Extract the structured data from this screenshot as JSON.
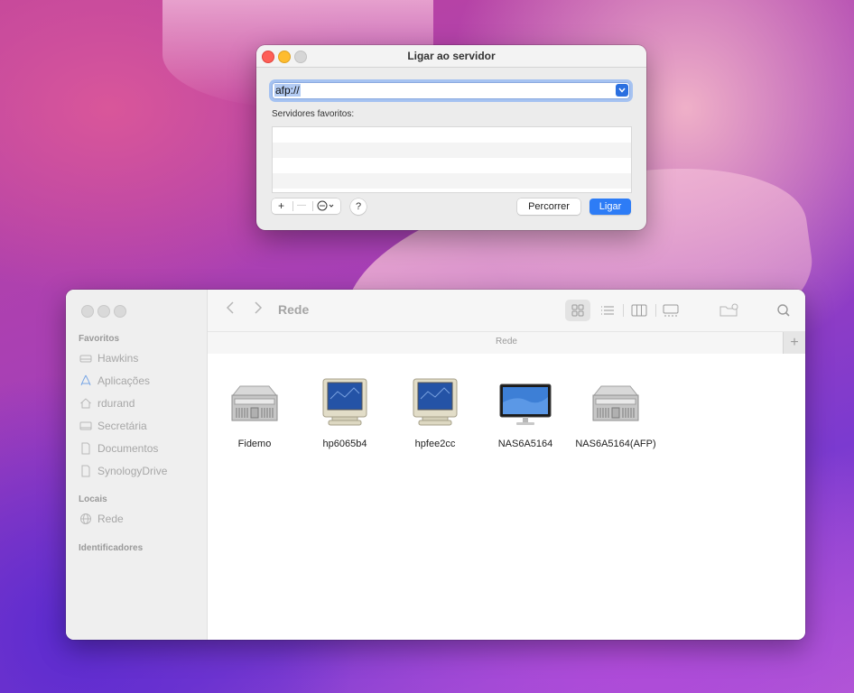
{
  "dialog": {
    "title": "Ligar ao servidor",
    "address_value": "afp://",
    "favorites_label": "Servidores favoritos:",
    "seg_add": "+",
    "seg_remove": "—",
    "seg_more": "⋯",
    "help_label": "?",
    "browse_label": "Percorrer",
    "connect_label": "Ligar"
  },
  "finder": {
    "title": "Rede",
    "path_title": "Rede",
    "plus_tab": "+",
    "sidebar": {
      "favorites_header": "Favoritos",
      "favorites": [
        {
          "label": "Hawkins",
          "icon": "hd-icon"
        },
        {
          "label": "Aplicações",
          "icon": "apps-icon"
        },
        {
          "label": "rdurand",
          "icon": "home-icon"
        },
        {
          "label": "Secretária",
          "icon": "desktop-icon"
        },
        {
          "label": "Documentos",
          "icon": "doc-icon"
        },
        {
          "label": "SynologyDrive",
          "icon": "doc-icon"
        }
      ],
      "locations_header": "Locais",
      "locations": [
        {
          "label": "Rede",
          "icon": "network-icon"
        }
      ],
      "tags_header": "Identificadores"
    },
    "items": [
      {
        "label": "Fidemo",
        "icon": "server-icon"
      },
      {
        "label": "hp6065b4",
        "icon": "crt-monitor-icon"
      },
      {
        "label": "hpfee2cc",
        "icon": "crt-monitor-icon"
      },
      {
        "label": "NAS6A5164",
        "icon": "display-icon"
      },
      {
        "label": "NAS6A5164(AFP)",
        "icon": "server-icon"
      }
    ]
  },
  "colors": {
    "accent": "#2d7cf6",
    "close": "#fe5f57",
    "minimize": "#febc2e"
  }
}
